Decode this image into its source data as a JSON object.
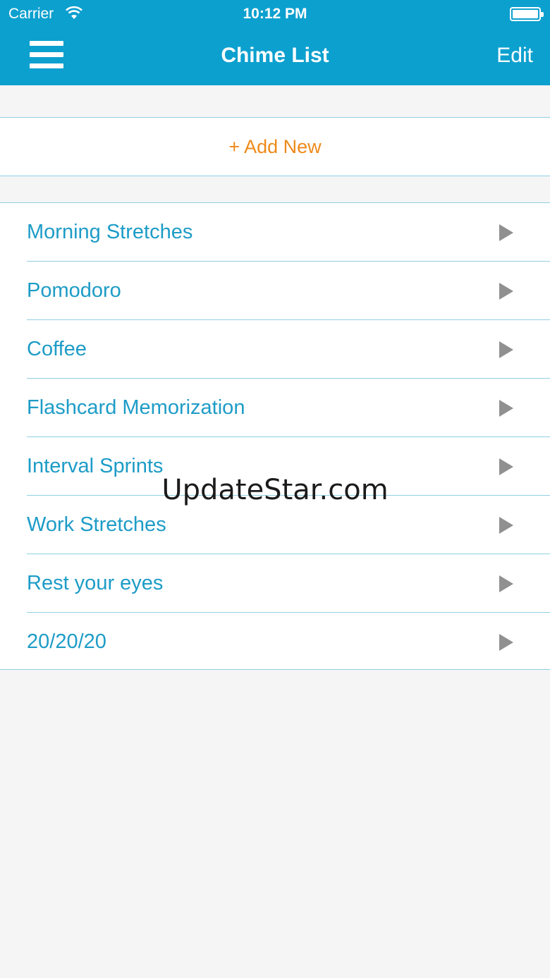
{
  "status_bar": {
    "carrier": "Carrier",
    "time": "10:12 PM",
    "wifi_icon": "wifi-icon",
    "battery_icon": "battery-icon",
    "battery_level": 1.0
  },
  "nav": {
    "title": "Chime List",
    "edit_label": "Edit",
    "menu_icon": "hamburger-menu-icon"
  },
  "add_new": {
    "label": "+ Add New",
    "color": "#ee8a1a"
  },
  "chimes": [
    {
      "label": "Morning Stretches"
    },
    {
      "label": "Pomodoro"
    },
    {
      "label": "Coffee"
    },
    {
      "label": "Flashcard Memorization"
    },
    {
      "label": "Interval Sprints"
    },
    {
      "label": "Work Stretches"
    },
    {
      "label": "Rest your eyes"
    },
    {
      "label": "20/20/20"
    }
  ],
  "watermark": "UpdateStar.com",
  "colors": {
    "accent": "#0ca0cf",
    "item_text": "#1d9cc7",
    "divider": "#8fd0e2",
    "chevron": "#8f8f8f"
  }
}
